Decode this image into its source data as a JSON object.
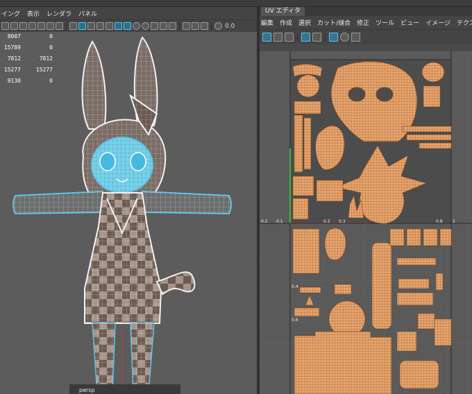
{
  "left_menu": [
    "イング",
    "表示",
    "レンダラ",
    "パネル"
  ],
  "left_toolbar_value": "0.0",
  "poly_stats": [
    [
      "8007",
      "0"
    ],
    [
      "15789",
      "0"
    ],
    [
      "7812",
      "7812"
    ],
    [
      "15277",
      "15277"
    ],
    [
      "9130",
      "0"
    ]
  ],
  "viewport_camera": "persp",
  "uv_editor": {
    "tab_label": "UV エディタ",
    "menu": [
      "編集",
      "作成",
      "選択",
      "カット/縫合",
      "修正",
      "ツール",
      "ビュー",
      "イメージ",
      "テクスチャ"
    ],
    "axis_ticks_h": [
      "0.2",
      "0.1",
      "0.2",
      "0.3",
      "0.9",
      "1"
    ],
    "axis_ticks_v": [
      "0.6",
      "0.4"
    ]
  },
  "colors": {
    "uv_shell_fill": "#e9a46c",
    "uv_wire": "#7a4a22",
    "selected_wire": "#5dc5ea",
    "mesh_dark": "#6c5a52",
    "mesh_light": "#a3928a"
  }
}
